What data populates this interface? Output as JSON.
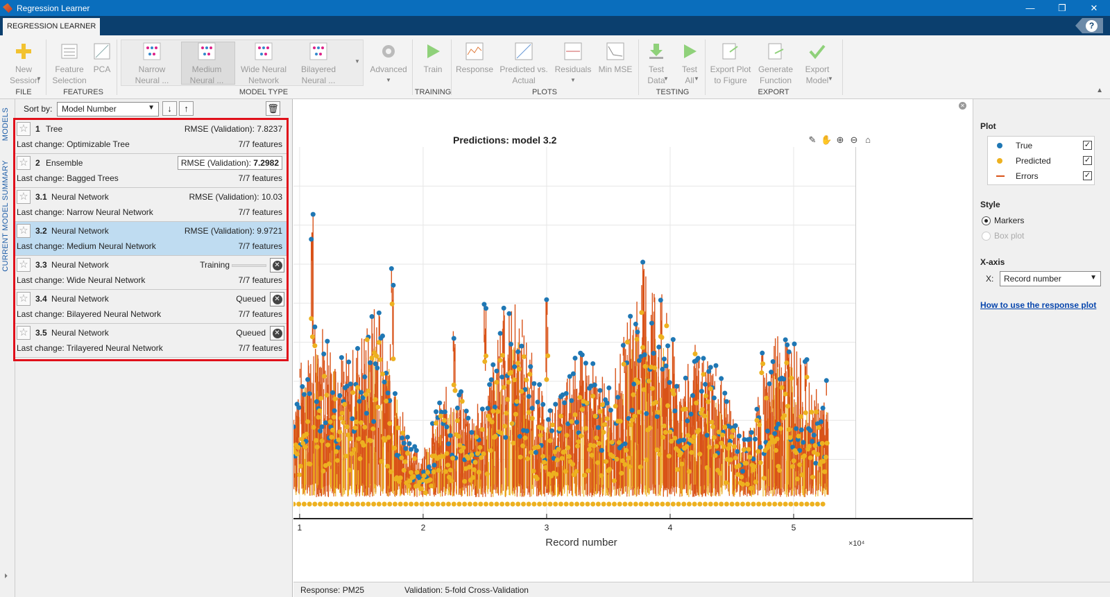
{
  "window": {
    "title": "Regression Learner",
    "controls": [
      "—",
      "❐",
      "✕"
    ]
  },
  "tab": {
    "label": "REGRESSION LEARNER",
    "help": "?"
  },
  "ribbon": {
    "buttons": [
      {
        "id": "new-session",
        "label": "New\nSession",
        "icon": "plus-icon"
      },
      {
        "id": "feature-selection",
        "label": "Feature\nSelection",
        "icon": "feature-selection-icon"
      },
      {
        "id": "pca",
        "label": "PCA",
        "icon": "pca-icon"
      },
      {
        "id": "narrow-neural",
        "label": "Narrow\nNeural ...",
        "icon": "neural-net-icon"
      },
      {
        "id": "medium-neural",
        "label": "Medium\nNeural ...",
        "icon": "neural-net-icon"
      },
      {
        "id": "wide-neural",
        "label": "Wide Neural\nNetwork",
        "icon": "neural-net-icon"
      },
      {
        "id": "bilayered-neural",
        "label": "Bilayered\nNeural ...",
        "icon": "neural-net-icon"
      },
      {
        "id": "advanced",
        "label": "Advanced",
        "icon": "gear-icon"
      },
      {
        "id": "train",
        "label": "Train",
        "icon": "play-icon"
      },
      {
        "id": "response",
        "label": "Response",
        "icon": "response-plot-icon"
      },
      {
        "id": "predicted-vs-actual",
        "label": "Predicted vs.\nActual",
        "icon": "scatter-plot-icon"
      },
      {
        "id": "residuals",
        "label": "Residuals",
        "icon": "residuals-plot-icon"
      },
      {
        "id": "min-mse",
        "label": "Min MSE",
        "icon": "min-mse-icon"
      },
      {
        "id": "test-data",
        "label": "Test\nData",
        "icon": "download-icon"
      },
      {
        "id": "test-all",
        "label": "Test\nAll",
        "icon": "play-icon"
      },
      {
        "id": "export-plot",
        "label": "Export Plot\nto Figure",
        "icon": "export-plot-icon"
      },
      {
        "id": "generate-function",
        "label": "Generate\nFunction",
        "icon": "generate-function-icon"
      },
      {
        "id": "export-model",
        "label": "Export\nModel",
        "icon": "checkmark-icon"
      }
    ],
    "groups": [
      "FILE",
      "FEATURES",
      "MODEL TYPE",
      "TRAINING",
      "PLOTS",
      "TESTING",
      "EXPORT"
    ]
  },
  "sidetabs": {
    "models": "MODELS",
    "summary": "CURRENT MODEL SUMMARY"
  },
  "sort": {
    "label": "Sort by:",
    "value": "Model Number"
  },
  "models": [
    {
      "num": "1",
      "name": "Tree",
      "status": "RMSE (Validation): 7.8237",
      "change_label": "Last change:",
      "change": "Optimizable Tree",
      "features": "7/7 features"
    },
    {
      "num": "2",
      "name": "Ensemble",
      "status_prefix": "RMSE (Validation): ",
      "status_value": "7.2982",
      "change_label": "Last change:",
      "change": "Bagged Trees",
      "features": "7/7 features"
    },
    {
      "num": "3.1",
      "name": "Neural Network",
      "status": "RMSE (Validation): 10.03",
      "change_label": "Last change:",
      "change": "Narrow Neural Network",
      "features": "7/7 features"
    },
    {
      "num": "3.2",
      "name": "Neural Network",
      "status": "RMSE (Validation): 9.9721",
      "change_label": "Last change:",
      "change": "Medium Neural Network",
      "features": "7/7 features"
    },
    {
      "num": "3.3",
      "name": "Neural Network",
      "status": "Training",
      "change_label": "Last change:",
      "change": "Wide Neural Network",
      "features": "7/7 features"
    },
    {
      "num": "3.4",
      "name": "Neural Network",
      "status": "Queued",
      "change_label": "Last change:",
      "change": "Bilayered Neural Network",
      "features": "7/7 features"
    },
    {
      "num": "3.5",
      "name": "Neural Network",
      "status": "Queued",
      "change_label": "Last change:",
      "change": "Trilayered Neural Network",
      "features": "7/7 features"
    }
  ],
  "plot": {
    "title": "Predictions: model 3.2",
    "xlabel": "Record number",
    "x_multiplier": "×10⁴",
    "xticks": [
      "1",
      "2",
      "3",
      "4",
      "5"
    ],
    "colors": {
      "true": "#1f77b4",
      "predicted": "#edb120",
      "errors": "#d95319"
    }
  },
  "chart_data": {
    "type": "scatter",
    "title": "Predictions: model 3.2",
    "xlabel": "Record number",
    "x_multiplier": "×10⁴",
    "xlim": [
      0.95,
      5.5
    ],
    "xticks": [
      1,
      2,
      3,
      4,
      5
    ],
    "yticks_labels_visible": false,
    "grid": true,
    "series": [
      {
        "name": "True",
        "color": "#1f77b4",
        "marker": "circle"
      },
      {
        "name": "Predicted",
        "color": "#edb120",
        "marker": "circle"
      },
      {
        "name": "Errors",
        "color": "#d95319",
        "marker": "line"
      }
    ]
  },
  "rightpanel": {
    "plot_heading": "Plot",
    "legend": [
      {
        "label": "True",
        "checked": "✓"
      },
      {
        "label": "Predicted",
        "checked": "✓"
      },
      {
        "label": "Errors",
        "checked": "✓"
      }
    ],
    "style_heading": "Style",
    "style_options": [
      "Markers",
      "Box plot"
    ],
    "xaxis_heading": "X-axis",
    "x_label": "X:",
    "x_value": "Record number",
    "help_link": "How to use the response plot"
  },
  "status": {
    "response": "Response: PM25",
    "validation": "Validation: 5-fold Cross-Validation"
  }
}
